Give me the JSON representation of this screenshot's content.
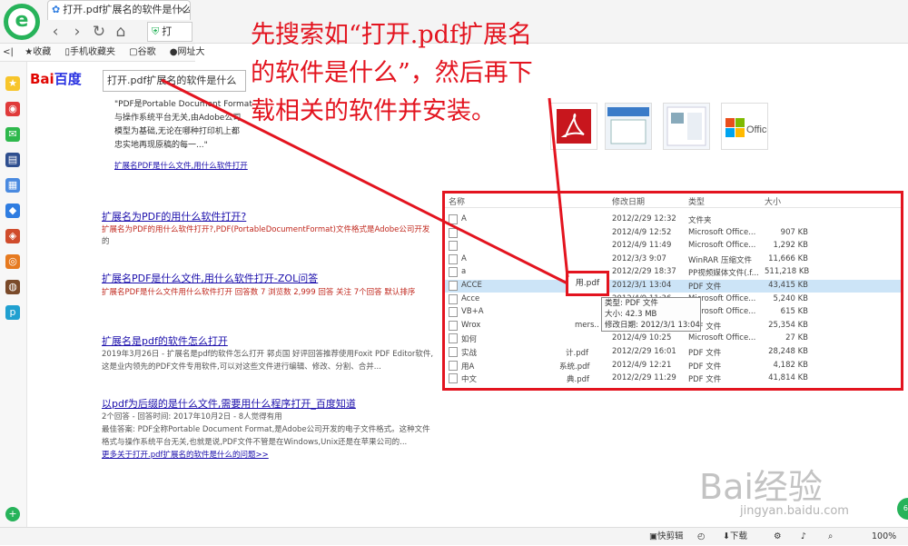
{
  "browser": {
    "tab_title": "打开.pdf扩展名的软件是什么_百",
    "address": "打",
    "bookmarks": [
      "收藏",
      "手机收藏夹",
      "谷歌",
      "网址大"
    ]
  },
  "search": {
    "logo_text_a": "Bai",
    "logo_text_b": "百度",
    "query": "打开.pdf扩展名的软件是什么"
  },
  "top_snippet": [
    "\"PDF是Portable Document Format",
    "与操作系统平台无关,由Adobe公司",
    "模型为基础,无论在哪种打印机上都",
    "忠实地再现原稿的每一...\"",
    "扩展名PDF是什么文件,用什么软件打开"
  ],
  "results": [
    {
      "title": "扩展名为PDF的用什么软件打开?",
      "desc": [
        "扩展名为PDF的用什么软件打开?,PDF(PortableDocumentFormat)文件格式是Adobe公司开发",
        "的"
      ]
    },
    {
      "title": "扩展名PDF是什么文件,用什么软件打开-ZOL问答",
      "desc": [
        "扩展名PDF是什么文件用什么软件打开 回答数 7 浏览数 2,999 回答 关注 7个回答 默认排序"
      ]
    },
    {
      "title": "扩展名是pdf的软件怎么打开",
      "desc": [
        "2019年3月26日 - 扩展名是pdf的软件怎么打开 郭贞国 好评回答推荐使用Foxit PDF Editor软件,",
        "这是业内领先的PDF文件专用软件,可以对这些文件进行编辑、修改、分割、合并..."
      ]
    },
    {
      "title": "以pdf为后缀的是什么文件,需要用什么程序打开_百度知道",
      "desc": [
        "2个回答 - 回答时间: 2017年10月2日 - 8人觉得有用",
        "最佳答案: PDF全称Portable Document Format,是Adobe公司开发的电子文件格式。这种文件",
        "格式与操作系统平台无关,也就是说,PDF文件不管是在Windows,Unix还是在苹果公司的..."
      ],
      "more": "更多关于打开.pdf扩展名的软件是什么的问题>>"
    }
  ],
  "annotation": "先搜索如“打开.pdf扩展名的软件是什么”，然后再下载相关的软件并安装。",
  "explorer": {
    "columns": [
      "名称",
      "修改日期",
      "类型",
      "大小"
    ],
    "rows": [
      {
        "name": "A",
        "date": "2012/2/29 12:32",
        "type": "文件夹",
        "size": ""
      },
      {
        "name": "",
        "date": "2012/4/9 12:52",
        "type": "Microsoft Office...",
        "size": "907 KB"
      },
      {
        "name": "",
        "date": "2012/4/9 11:49",
        "type": "Microsoft Office...",
        "size": "1,292 KB"
      },
      {
        "name": "A",
        "date": "2012/3/3 9:07",
        "type": "WinRAR 压缩文件",
        "size": "11,666 KB"
      },
      {
        "name": "a",
        "date": "2012/2/29 18:37",
        "type": "PP视频媒体文件(.f...",
        "size": "511,218 KB"
      },
      {
        "name": "ACCE",
        "date": "2012/3/1 13:04",
        "type": "PDF 文件",
        "size": "43,415 KB"
      },
      {
        "name": "Acce",
        "date": "2012/4/9 11:36",
        "type": "Microsoft Office...",
        "size": "5,240 KB"
      },
      {
        "name": "VB+A",
        "date": "2012/4/9 12:13",
        "type": "Microsoft Office...",
        "size": "615 KB"
      },
      {
        "name": "Wrox",
        "date": "2012/2/29 12:51",
        "type": "PDF 文件",
        "size": "25,354 KB"
      },
      {
        "name": "如何",
        "date": "2012/4/9 10:25",
        "type": "Microsoft Office...",
        "size": "27 KB"
      },
      {
        "name": "实战",
        "date": "2012/2/29 16:01",
        "type": "PDF 文件",
        "size": "28,248 KB"
      },
      {
        "name": "用A",
        "date": "2012/4/9 12:21",
        "type": "PDF 文件",
        "size": "4,182 KB"
      },
      {
        "name": "中文",
        "date": "2012/2/29 11:29",
        "type": "PDF 文件",
        "size": "41,814 KB"
      }
    ],
    "fragments": [
      "mers..",
      "计.pdf",
      "系统.pdf",
      "典.pdf"
    ],
    "highlight": "用.pdf",
    "tooltip": [
      "类型: PDF 文件",
      "大小: 42.3 MB",
      "修改日期: 2012/3/1 13:04"
    ]
  },
  "status": {
    "items": [
      "快剪辑",
      "下载",
      "100%"
    ]
  },
  "watermark": {
    "brand": "Bai经验",
    "url": "jingyan.baidu.com"
  },
  "colors": {
    "annotation_red": "#e3141f",
    "link_blue": "#1a0dab",
    "brand_green": "#27b35a"
  }
}
